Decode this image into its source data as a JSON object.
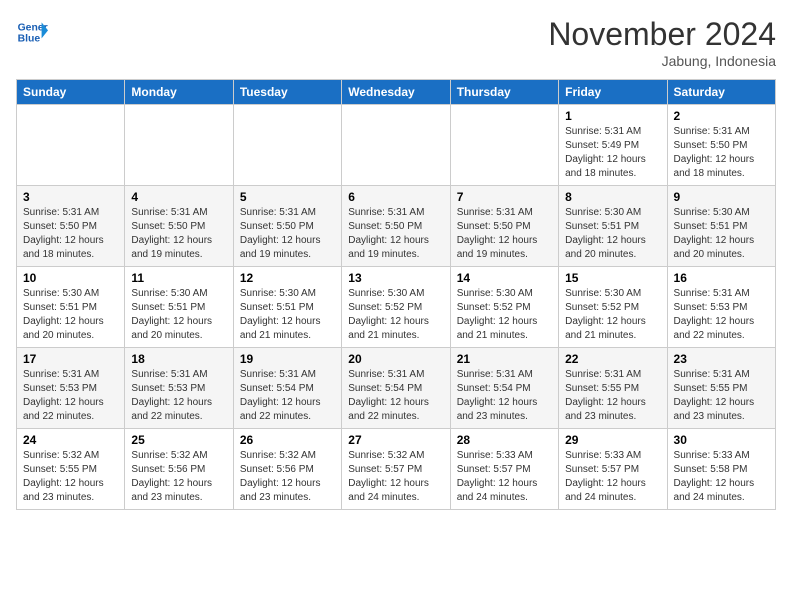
{
  "header": {
    "logo_line1": "General",
    "logo_line2": "Blue",
    "month": "November 2024",
    "location": "Jabung, Indonesia"
  },
  "weekdays": [
    "Sunday",
    "Monday",
    "Tuesday",
    "Wednesday",
    "Thursday",
    "Friday",
    "Saturday"
  ],
  "weeks": [
    [
      {
        "day": "",
        "info": ""
      },
      {
        "day": "",
        "info": ""
      },
      {
        "day": "",
        "info": ""
      },
      {
        "day": "",
        "info": ""
      },
      {
        "day": "",
        "info": ""
      },
      {
        "day": "1",
        "info": "Sunrise: 5:31 AM\nSunset: 5:49 PM\nDaylight: 12 hours and 18 minutes."
      },
      {
        "day": "2",
        "info": "Sunrise: 5:31 AM\nSunset: 5:50 PM\nDaylight: 12 hours and 18 minutes."
      }
    ],
    [
      {
        "day": "3",
        "info": "Sunrise: 5:31 AM\nSunset: 5:50 PM\nDaylight: 12 hours and 18 minutes."
      },
      {
        "day": "4",
        "info": "Sunrise: 5:31 AM\nSunset: 5:50 PM\nDaylight: 12 hours and 19 minutes."
      },
      {
        "day": "5",
        "info": "Sunrise: 5:31 AM\nSunset: 5:50 PM\nDaylight: 12 hours and 19 minutes."
      },
      {
        "day": "6",
        "info": "Sunrise: 5:31 AM\nSunset: 5:50 PM\nDaylight: 12 hours and 19 minutes."
      },
      {
        "day": "7",
        "info": "Sunrise: 5:31 AM\nSunset: 5:50 PM\nDaylight: 12 hours and 19 minutes."
      },
      {
        "day": "8",
        "info": "Sunrise: 5:30 AM\nSunset: 5:51 PM\nDaylight: 12 hours and 20 minutes."
      },
      {
        "day": "9",
        "info": "Sunrise: 5:30 AM\nSunset: 5:51 PM\nDaylight: 12 hours and 20 minutes."
      }
    ],
    [
      {
        "day": "10",
        "info": "Sunrise: 5:30 AM\nSunset: 5:51 PM\nDaylight: 12 hours and 20 minutes."
      },
      {
        "day": "11",
        "info": "Sunrise: 5:30 AM\nSunset: 5:51 PM\nDaylight: 12 hours and 20 minutes."
      },
      {
        "day": "12",
        "info": "Sunrise: 5:30 AM\nSunset: 5:51 PM\nDaylight: 12 hours and 21 minutes."
      },
      {
        "day": "13",
        "info": "Sunrise: 5:30 AM\nSunset: 5:52 PM\nDaylight: 12 hours and 21 minutes."
      },
      {
        "day": "14",
        "info": "Sunrise: 5:30 AM\nSunset: 5:52 PM\nDaylight: 12 hours and 21 minutes."
      },
      {
        "day": "15",
        "info": "Sunrise: 5:30 AM\nSunset: 5:52 PM\nDaylight: 12 hours and 21 minutes."
      },
      {
        "day": "16",
        "info": "Sunrise: 5:31 AM\nSunset: 5:53 PM\nDaylight: 12 hours and 22 minutes."
      }
    ],
    [
      {
        "day": "17",
        "info": "Sunrise: 5:31 AM\nSunset: 5:53 PM\nDaylight: 12 hours and 22 minutes."
      },
      {
        "day": "18",
        "info": "Sunrise: 5:31 AM\nSunset: 5:53 PM\nDaylight: 12 hours and 22 minutes."
      },
      {
        "day": "19",
        "info": "Sunrise: 5:31 AM\nSunset: 5:54 PM\nDaylight: 12 hours and 22 minutes."
      },
      {
        "day": "20",
        "info": "Sunrise: 5:31 AM\nSunset: 5:54 PM\nDaylight: 12 hours and 22 minutes."
      },
      {
        "day": "21",
        "info": "Sunrise: 5:31 AM\nSunset: 5:54 PM\nDaylight: 12 hours and 23 minutes."
      },
      {
        "day": "22",
        "info": "Sunrise: 5:31 AM\nSunset: 5:55 PM\nDaylight: 12 hours and 23 minutes."
      },
      {
        "day": "23",
        "info": "Sunrise: 5:31 AM\nSunset: 5:55 PM\nDaylight: 12 hours and 23 minutes."
      }
    ],
    [
      {
        "day": "24",
        "info": "Sunrise: 5:32 AM\nSunset: 5:55 PM\nDaylight: 12 hours and 23 minutes."
      },
      {
        "day": "25",
        "info": "Sunrise: 5:32 AM\nSunset: 5:56 PM\nDaylight: 12 hours and 23 minutes."
      },
      {
        "day": "26",
        "info": "Sunrise: 5:32 AM\nSunset: 5:56 PM\nDaylight: 12 hours and 23 minutes."
      },
      {
        "day": "27",
        "info": "Sunrise: 5:32 AM\nSunset: 5:57 PM\nDaylight: 12 hours and 24 minutes."
      },
      {
        "day": "28",
        "info": "Sunrise: 5:33 AM\nSunset: 5:57 PM\nDaylight: 12 hours and 24 minutes."
      },
      {
        "day": "29",
        "info": "Sunrise: 5:33 AM\nSunset: 5:57 PM\nDaylight: 12 hours and 24 minutes."
      },
      {
        "day": "30",
        "info": "Sunrise: 5:33 AM\nSunset: 5:58 PM\nDaylight: 12 hours and 24 minutes."
      }
    ]
  ]
}
